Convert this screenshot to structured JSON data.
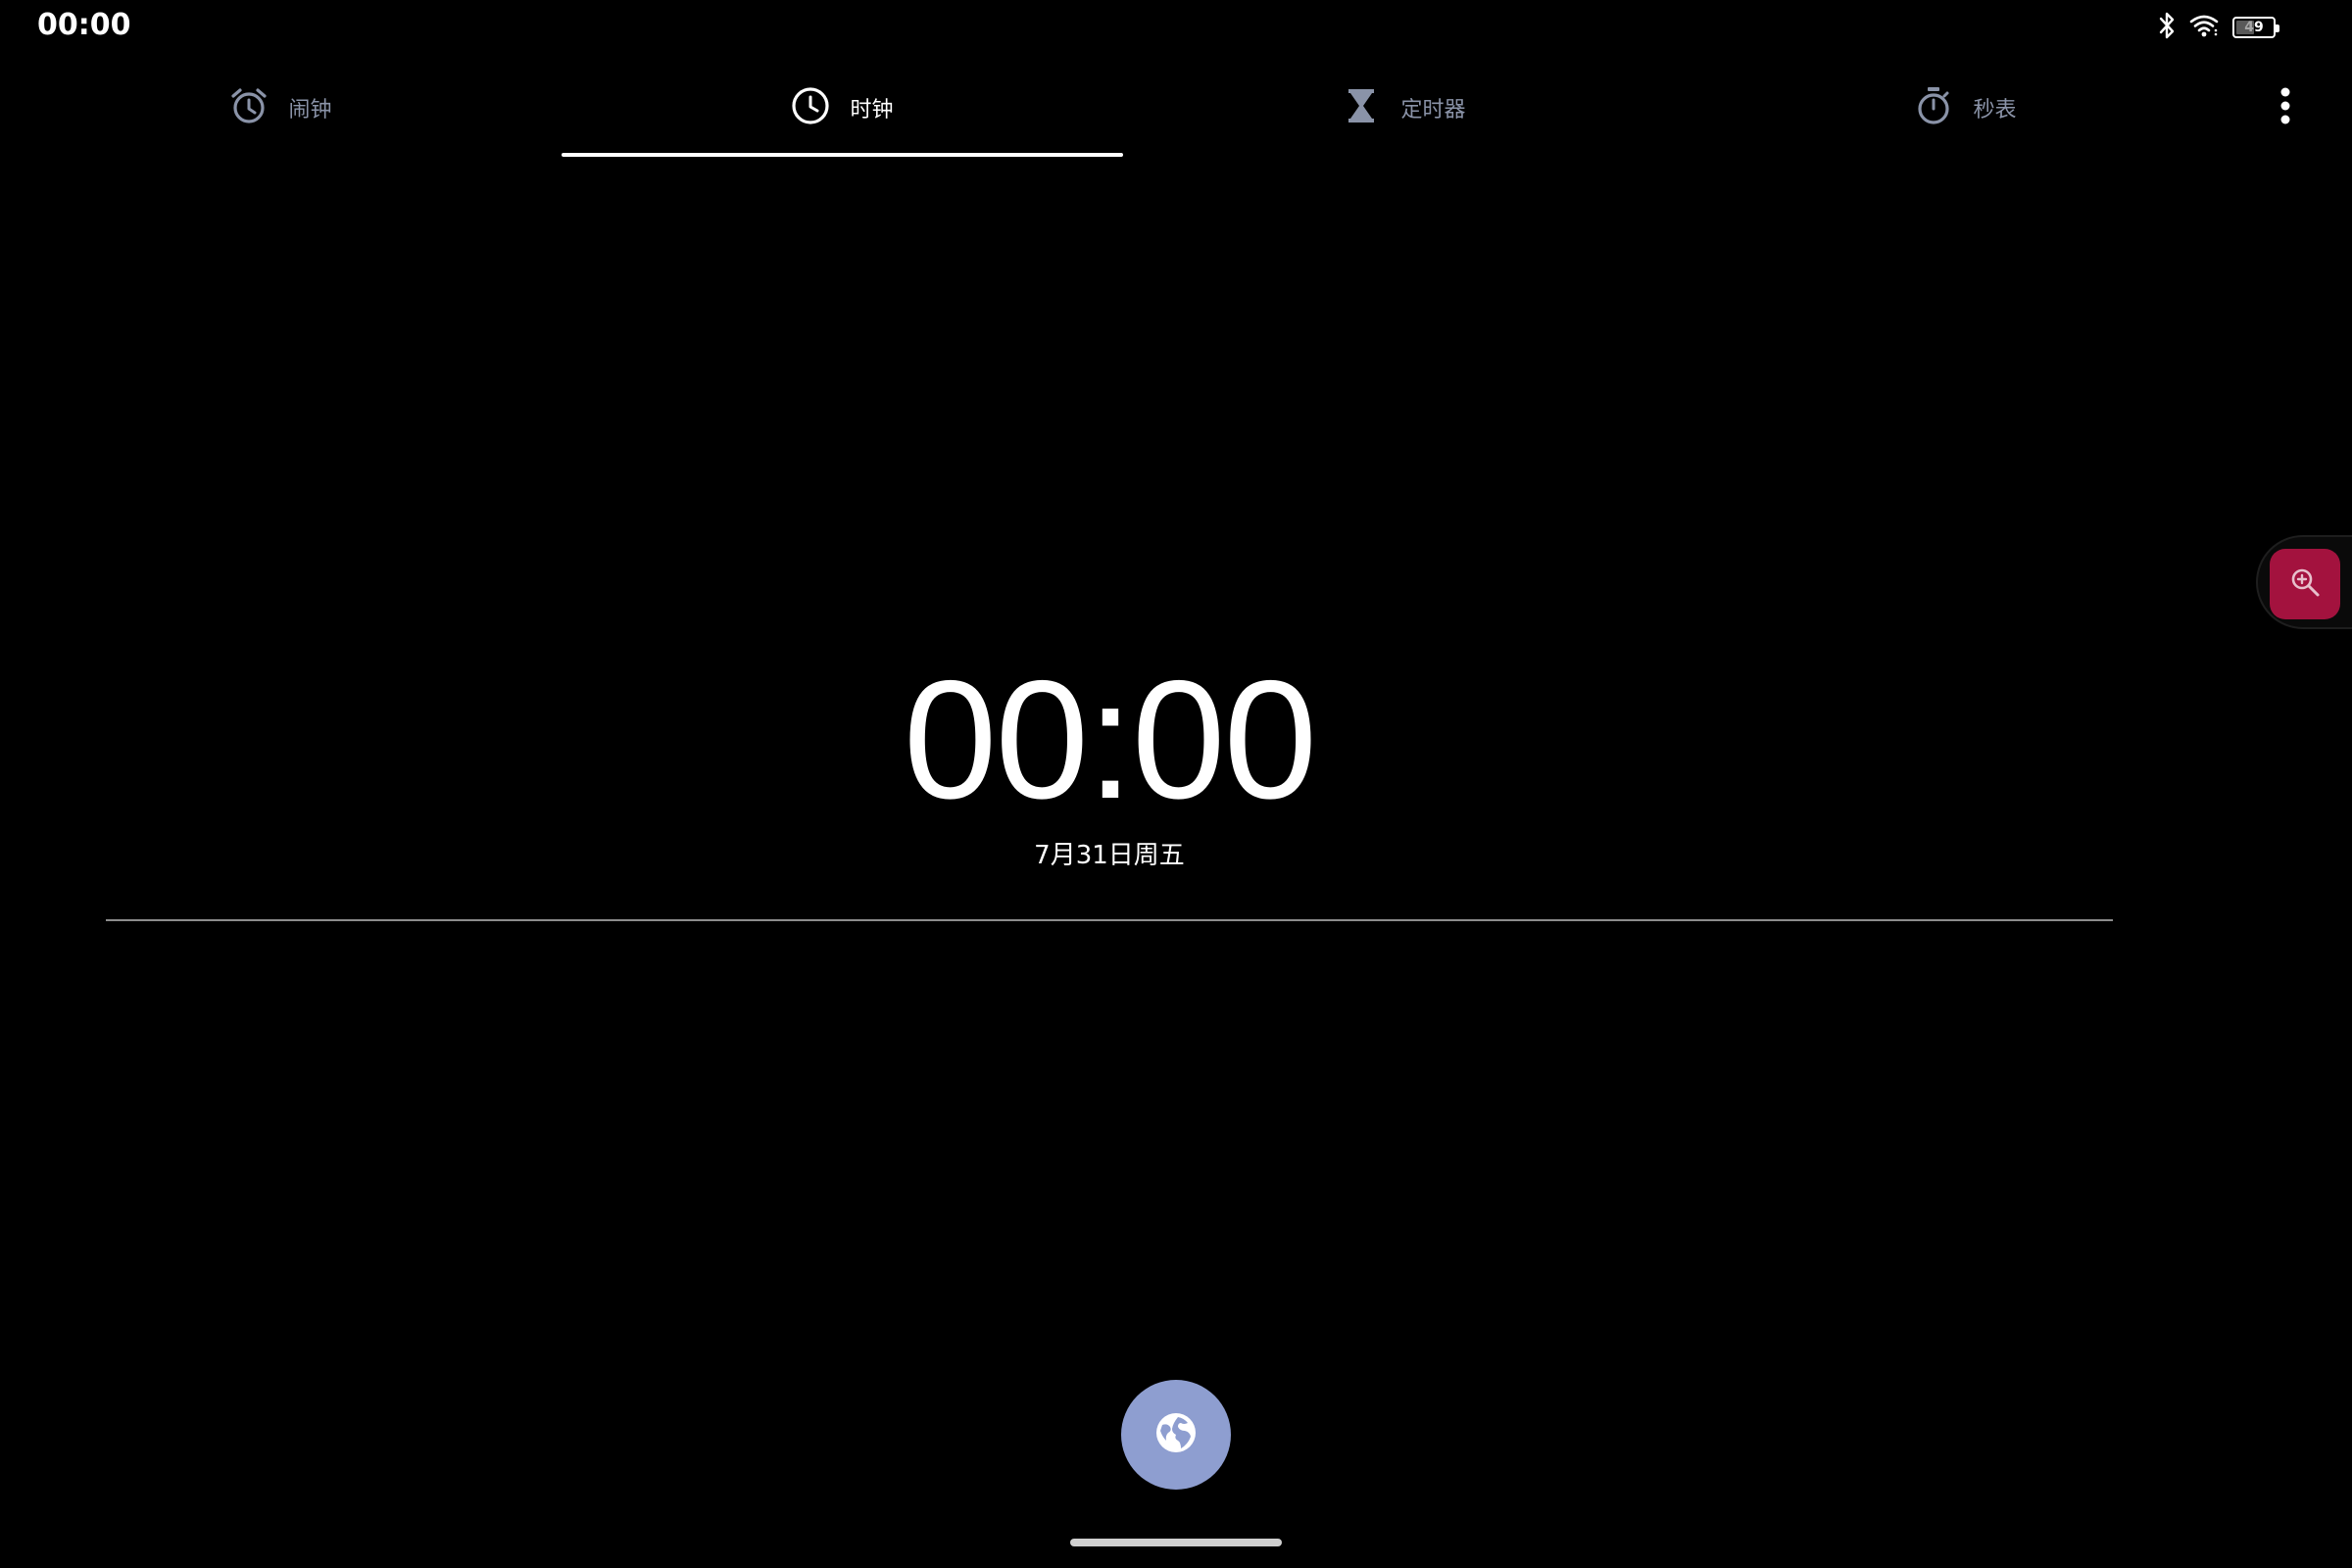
{
  "status_bar": {
    "time": "00:00",
    "battery_level": "49",
    "battery_fraction": 0.49,
    "icons": [
      "bluetooth-icon",
      "wifi-icon",
      "battery-icon"
    ]
  },
  "tabs": [
    {
      "label": "闹钟",
      "icon": "alarm-clock-icon",
      "active": false
    },
    {
      "label": "时钟",
      "icon": "clock-icon",
      "active": true
    },
    {
      "label": "定时器",
      "icon": "hourglass-icon",
      "active": false
    },
    {
      "label": "秒表",
      "icon": "stopwatch-icon",
      "active": false
    }
  ],
  "clock": {
    "time": "00:00",
    "date": "7月31日周五"
  },
  "actions": {
    "fab_icon": "globe-icon",
    "overflow_icon": "more-vert-icon",
    "floating_icon": "zoom-in-icon"
  },
  "colors": {
    "background": "#000000",
    "inactive_tab": "#8a93a8",
    "fab": "#8e9ed0",
    "floating_button": "#a3123e"
  }
}
